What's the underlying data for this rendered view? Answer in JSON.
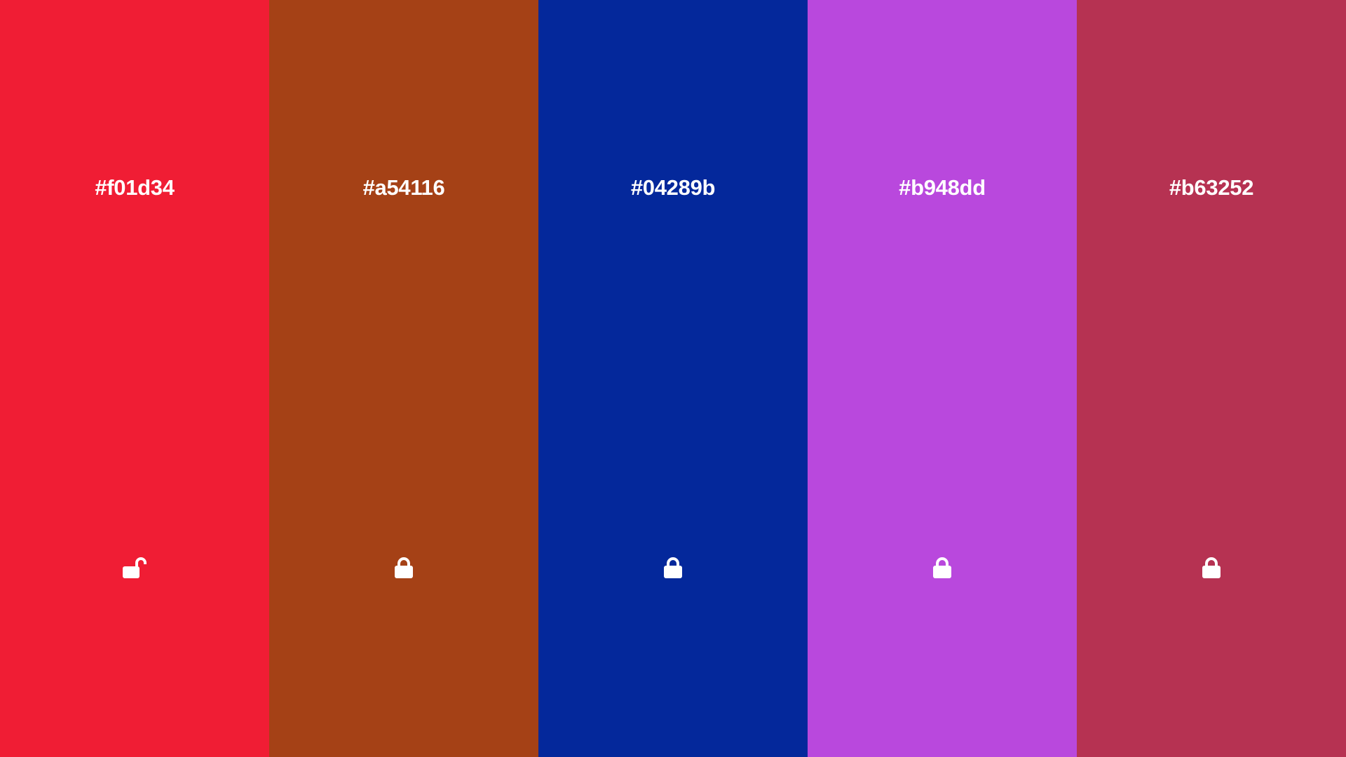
{
  "swatches": [
    {
      "hex": "#f01d34",
      "color": "#f01d34",
      "locked": false,
      "icon": "unlocked-padlock-icon"
    },
    {
      "hex": "#a54116",
      "color": "#a54116",
      "locked": true,
      "icon": "locked-padlock-icon"
    },
    {
      "hex": "#04289b",
      "color": "#04289b",
      "locked": true,
      "icon": "locked-padlock-icon"
    },
    {
      "hex": "#b948dd",
      "color": "#b948dd",
      "locked": true,
      "icon": "locked-padlock-icon"
    },
    {
      "hex": "#b63252",
      "color": "#b63252",
      "locked": true,
      "icon": "locked-padlock-icon"
    }
  ]
}
